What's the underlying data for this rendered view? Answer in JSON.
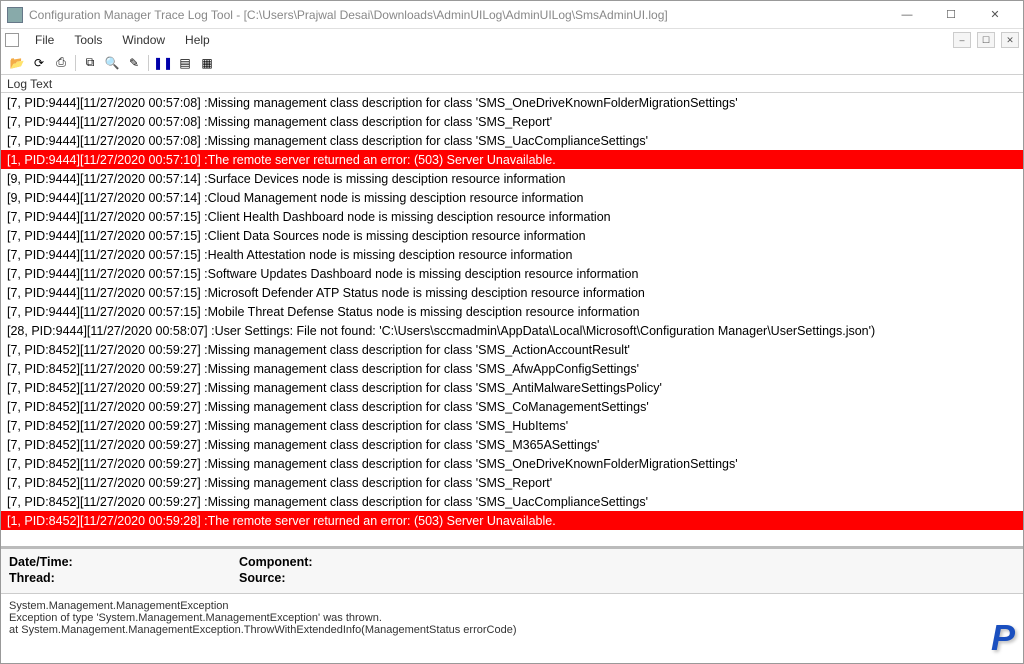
{
  "window": {
    "title": "Configuration Manager Trace Log Tool - [C:\\Users\\Prajwal Desai\\Downloads\\AdminUILog\\AdminUILog\\SmsAdminUI.log]",
    "min": "—",
    "max": "☐",
    "close": "✕"
  },
  "menu": {
    "file": "File",
    "tools": "Tools",
    "window": "Window",
    "help": "Help"
  },
  "toolbar": {
    "open": "📂",
    "refresh": "⟳",
    "print": "⎙",
    "copy": "⧉",
    "find": "🔍",
    "highlight": "✎",
    "pause": "❚❚",
    "view1": "▤",
    "view2": "▦"
  },
  "header": {
    "log_text": "Log Text"
  },
  "logs": [
    {
      "err": false,
      "text": "[7, PID:9444][11/27/2020 00:57:08] :Missing management class description for class 'SMS_OneDriveKnownFolderMigrationSettings'"
    },
    {
      "err": false,
      "text": "[7, PID:9444][11/27/2020 00:57:08] :Missing management class description for class 'SMS_Report'"
    },
    {
      "err": false,
      "text": "[7, PID:9444][11/27/2020 00:57:08] :Missing management class description for class 'SMS_UacComplianceSettings'"
    },
    {
      "err": true,
      "text": "[1, PID:9444][11/27/2020 00:57:10] :The remote server returned an error: (503) Server Unavailable."
    },
    {
      "err": false,
      "text": "[9, PID:9444][11/27/2020 00:57:14] :Surface Devices node is missing desciption resource information"
    },
    {
      "err": false,
      "text": "[9, PID:9444][11/27/2020 00:57:14] :Cloud Management node is missing desciption resource information"
    },
    {
      "err": false,
      "text": "[7, PID:9444][11/27/2020 00:57:15] :Client Health Dashboard node is missing desciption resource information"
    },
    {
      "err": false,
      "text": "[7, PID:9444][11/27/2020 00:57:15] :Client Data Sources node is missing desciption resource information"
    },
    {
      "err": false,
      "text": "[7, PID:9444][11/27/2020 00:57:15] :Health Attestation node is missing desciption resource information"
    },
    {
      "err": false,
      "text": "[7, PID:9444][11/27/2020 00:57:15] :Software Updates Dashboard node is missing desciption resource information"
    },
    {
      "err": false,
      "text": "[7, PID:9444][11/27/2020 00:57:15] :Microsoft Defender ATP Status node is missing desciption resource information"
    },
    {
      "err": false,
      "text": "[7, PID:9444][11/27/2020 00:57:15] :Mobile Threat Defense Status node is missing desciption resource information"
    },
    {
      "err": false,
      "text": "[28, PID:9444][11/27/2020 00:58:07] :User Settings: File not found: 'C:\\Users\\sccmadmin\\AppData\\Local\\Microsoft\\Configuration Manager\\UserSettings.json')"
    },
    {
      "err": false,
      "text": "[7, PID:8452][11/27/2020 00:59:27] :Missing management class description for class 'SMS_ActionAccountResult'"
    },
    {
      "err": false,
      "text": "[7, PID:8452][11/27/2020 00:59:27] :Missing management class description for class 'SMS_AfwAppConfigSettings'"
    },
    {
      "err": false,
      "text": "[7, PID:8452][11/27/2020 00:59:27] :Missing management class description for class 'SMS_AntiMalwareSettingsPolicy'"
    },
    {
      "err": false,
      "text": "[7, PID:8452][11/27/2020 00:59:27] :Missing management class description for class 'SMS_CoManagementSettings'"
    },
    {
      "err": false,
      "text": "[7, PID:8452][11/27/2020 00:59:27] :Missing management class description for class 'SMS_HubItems'"
    },
    {
      "err": false,
      "text": "[7, PID:8452][11/27/2020 00:59:27] :Missing management class description for class 'SMS_M365ASettings'"
    },
    {
      "err": false,
      "text": "[7, PID:8452][11/27/2020 00:59:27] :Missing management class description for class 'SMS_OneDriveKnownFolderMigrationSettings'"
    },
    {
      "err": false,
      "text": "[7, PID:8452][11/27/2020 00:59:27] :Missing management class description for class 'SMS_Report'"
    },
    {
      "err": false,
      "text": "[7, PID:8452][11/27/2020 00:59:27] :Missing management class description for class 'SMS_UacComplianceSettings'"
    },
    {
      "err": true,
      "text": "[1, PID:8452][11/27/2020 00:59:28] :The remote server returned an error: (503) Server Unavailable."
    }
  ],
  "details": {
    "datetime_label": "Date/Time:",
    "component_label": "Component:",
    "thread_label": "Thread:",
    "source_label": "Source:"
  },
  "exception": {
    "l1": "System.Management.ManagementException",
    "l2": "Exception of type 'System.Management.ManagementException' was thrown.",
    "l3": "   at System.Management.ManagementException.ThrowWithExtendedInfo(ManagementStatus errorCode)"
  },
  "watermark": "P"
}
